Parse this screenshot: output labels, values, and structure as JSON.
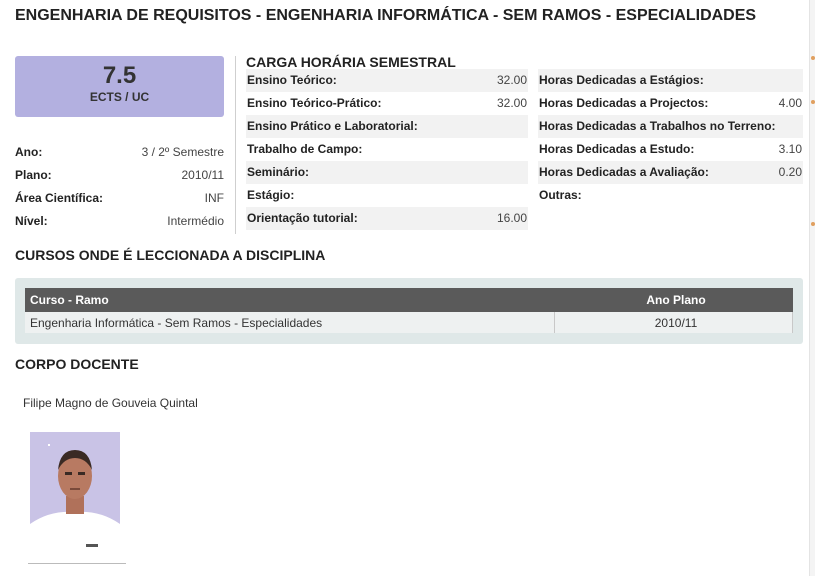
{
  "page_title": "ENGENHARIA DE REQUISITOS - ENGENHARIA INFORMÁTICA - SEM RAMOS - ESPECIALIDADES",
  "ects": {
    "value": "7.5",
    "label": "ECTS / UC"
  },
  "info": [
    {
      "label": "Ano:",
      "value": "3 / 2º Semestre"
    },
    {
      "label": "Plano:",
      "value": "2010/11"
    },
    {
      "label": "Área Científica:",
      "value": "INF"
    },
    {
      "label": "Nível:",
      "value": "Intermédio"
    }
  ],
  "carga": {
    "title": "CARGA HORÁRIA SEMESTRAL",
    "left": [
      {
        "label": "Ensino Teórico:",
        "value": "32.00"
      },
      {
        "label": "Ensino Teórico-Prático:",
        "value": "32.00"
      },
      {
        "label": "Ensino Prático e Laboratorial:",
        "value": ""
      },
      {
        "label": "Trabalho de Campo:",
        "value": ""
      },
      {
        "label": "Seminário:",
        "value": ""
      },
      {
        "label": "Estágio:",
        "value": ""
      },
      {
        "label": "Orientação tutorial:",
        "value": "16.00"
      }
    ],
    "right": [
      {
        "label": "Horas Dedicadas a Estágios:",
        "value": ""
      },
      {
        "label": "Horas Dedicadas a Projectos:",
        "value": "4.00"
      },
      {
        "label": "Horas Dedicadas a Trabalhos no Terreno:",
        "value": ""
      },
      {
        "label": "Horas Dedicadas a Estudo:",
        "value": "3.10"
      },
      {
        "label": "Horas Dedicadas a Avaliação:",
        "value": "0.20"
      },
      {
        "label": "Outras:",
        "value": ""
      }
    ]
  },
  "cursos": {
    "title": "CURSOS ONDE É LECCIONADA A DISCIPLINA",
    "headers": [
      "Curso - Ramo",
      "Ano Plano"
    ],
    "rows": [
      [
        "Engenharia Informática - Sem Ramos - Especialidades",
        "2010/11"
      ]
    ]
  },
  "docentes": {
    "title": "CORPO DOCENTE",
    "teachers": [
      {
        "name": "Filipe Magno de Gouveia Quintal"
      }
    ]
  },
  "colors": {
    "ects_box": "#b3b0e0",
    "table_header": "#5a5a5a",
    "table_panel": "#dfe8e8"
  }
}
